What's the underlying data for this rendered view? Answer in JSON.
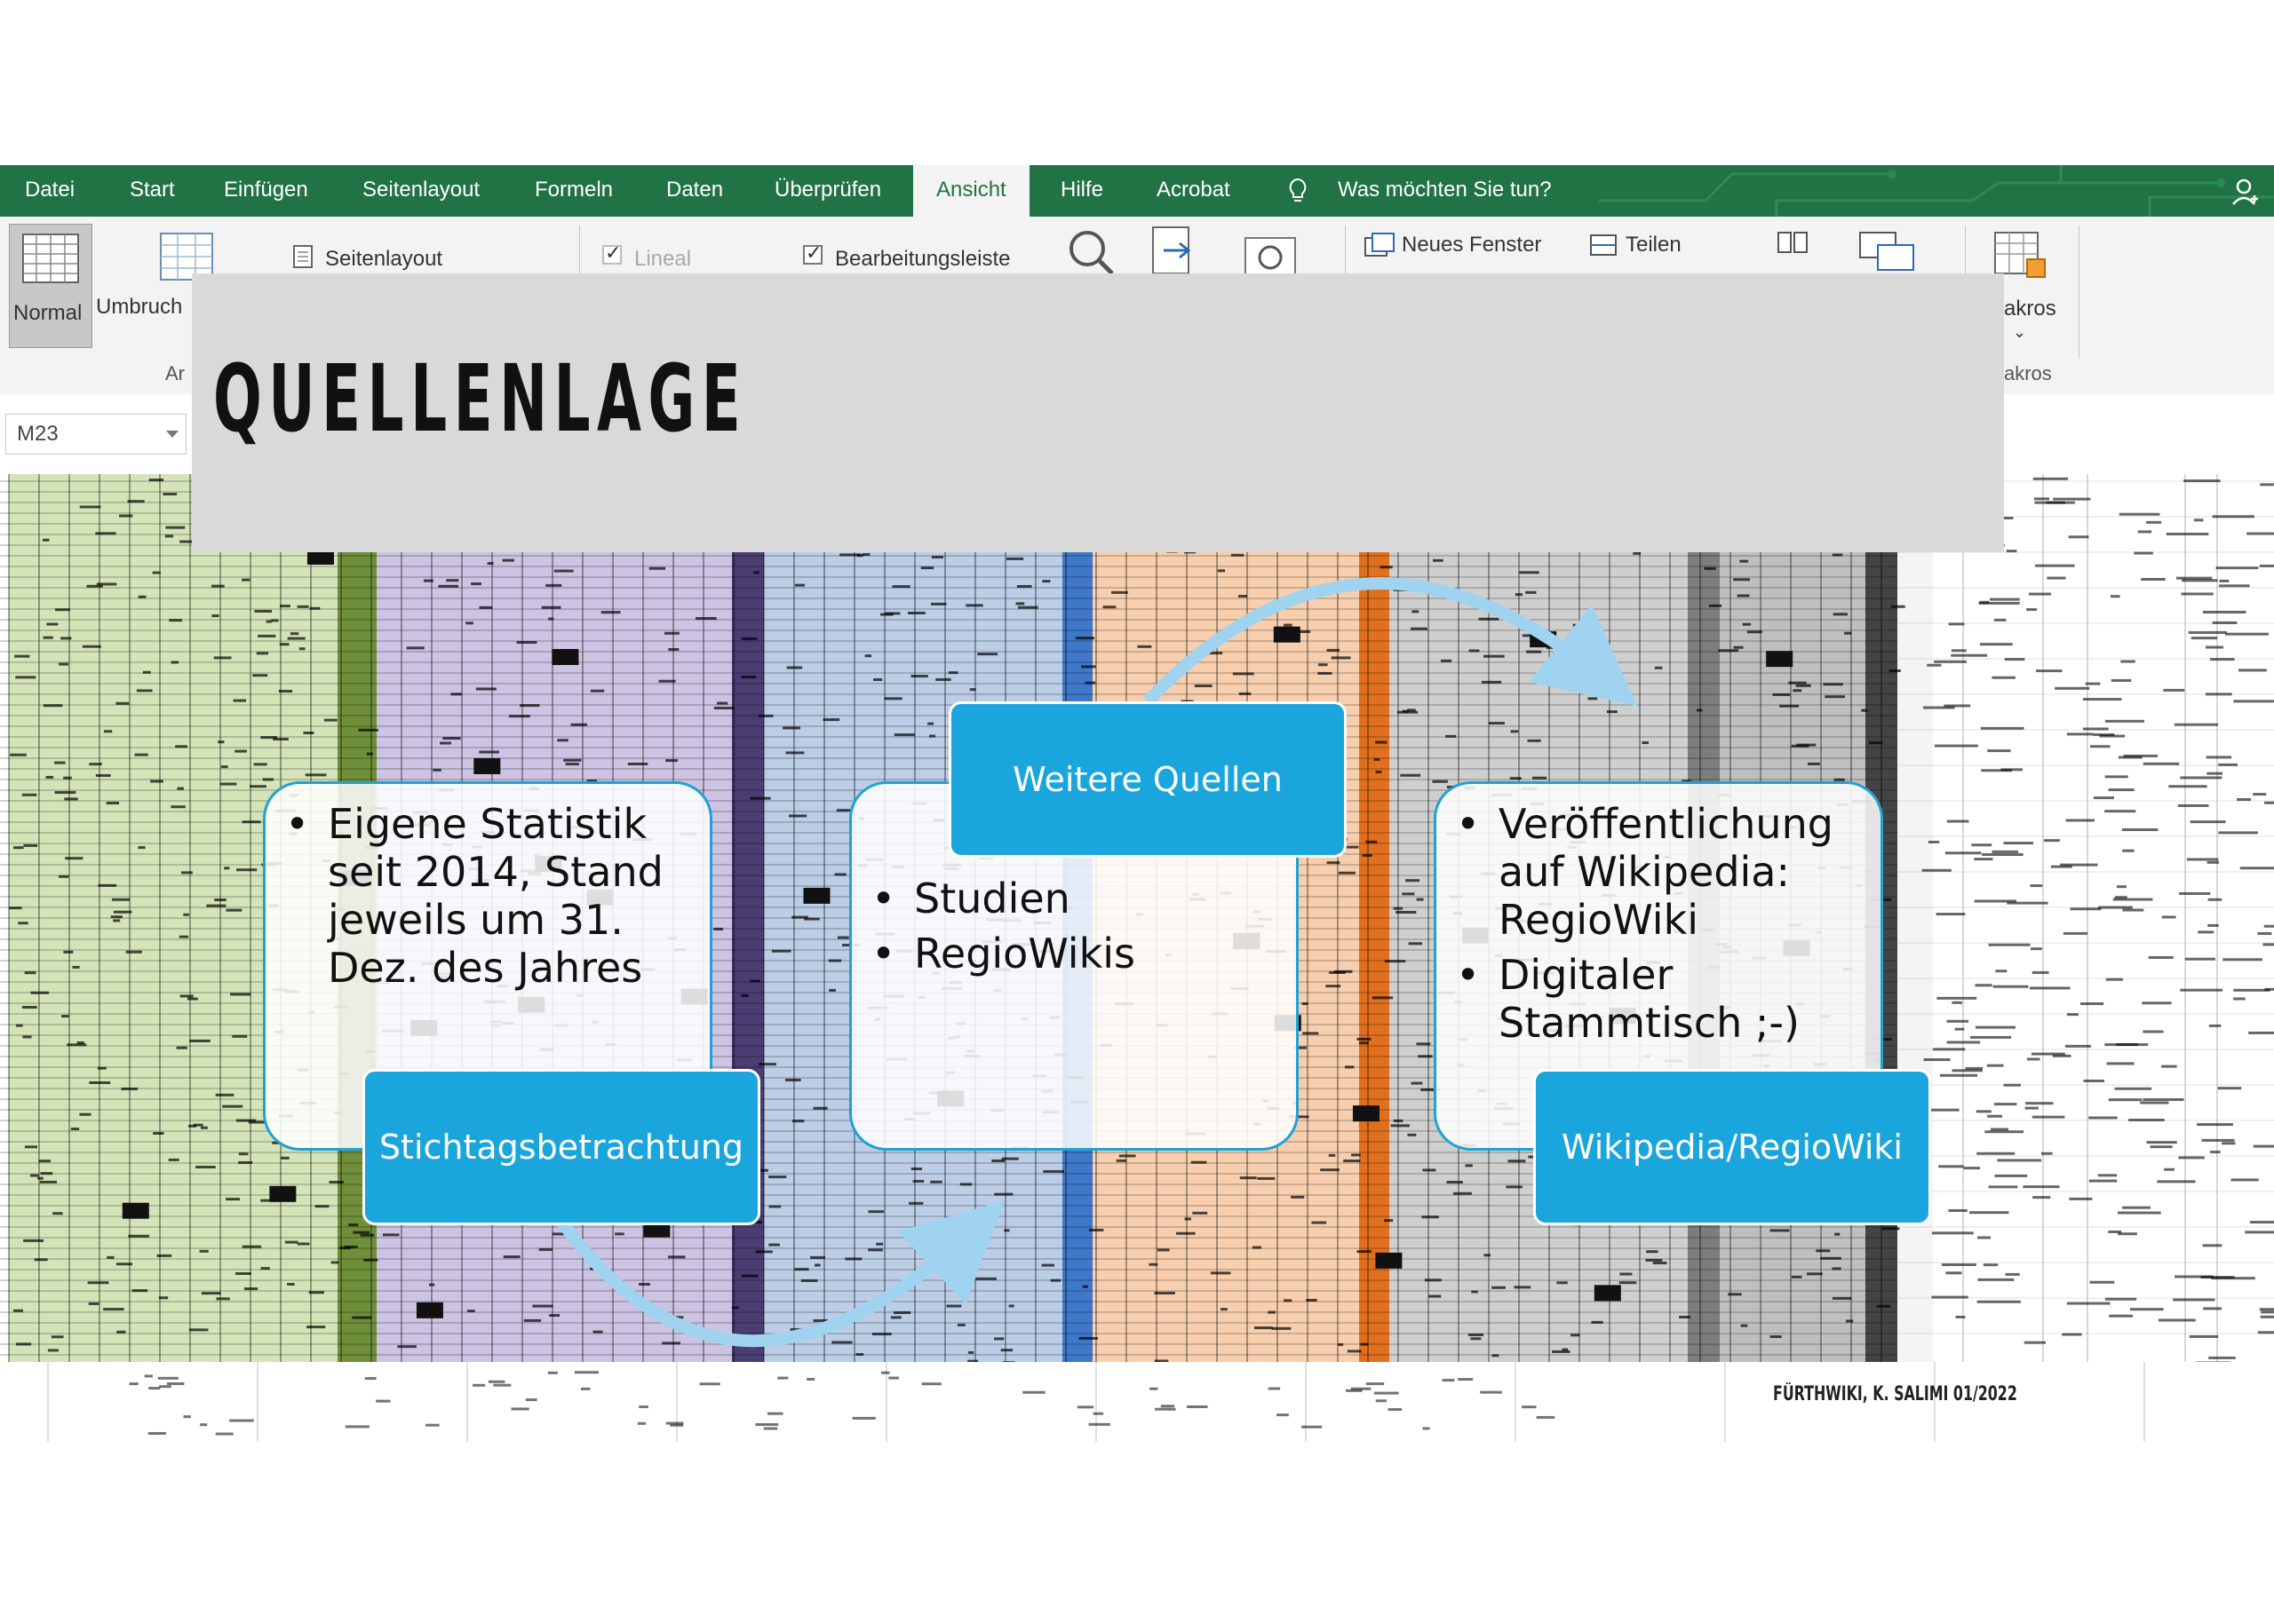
{
  "ribbon": {
    "tabs": [
      "Datei",
      "Start",
      "Einfügen",
      "Seitenlayout",
      "Formeln",
      "Daten",
      "Überprüfen",
      "Ansicht",
      "Hilfe",
      "Acrobat"
    ],
    "active_tab": "Ansicht",
    "tell_me": "Was möchten Sie tun?",
    "accent_color": "#217346"
  },
  "ribbon_body": {
    "normal_label": "Normal",
    "umbruch_label": "Umbruch",
    "seitenlayout_label": "Seitenlayout",
    "lineal_label": "Lineal",
    "lineal_checked": true,
    "bearbeitungsleiste_label": "Bearbeitungsleiste",
    "bearbeitungsleiste_checked": true,
    "neues_fenster_label": "Neues Fenster",
    "teilen_label": "Teilen",
    "makros_label_top": "akros",
    "makros_label_bottom": "akros",
    "group_label_ar": "Ar"
  },
  "name_box": {
    "value": "M23"
  },
  "slide": {
    "title": "QUELLENLAGE",
    "credit": "FÜRTHWIKI, K. SALIMI 01/2022"
  },
  "process": [
    {
      "label": "Stichtagsbetrachtung",
      "bullets": [
        "Eigene Statistik seit 2014, Stand jeweils um 31. Dez. des Jahres"
      ]
    },
    {
      "label": "Weitere Quellen",
      "bullets": [
        "Studien",
        "RegioWikis"
      ]
    },
    {
      "label": "Wikipedia/RegioWiki",
      "bullets": [
        "Veröffentlichung auf Wikipedia: RegioWiki",
        "Digitaler Stammtisch ;-)"
      ]
    }
  ],
  "colors": {
    "card_border": "#1ea2d4",
    "label_fill": "#1aa6dc",
    "arrow": "#9fd3ef",
    "title_band": "#d9d9d9"
  }
}
